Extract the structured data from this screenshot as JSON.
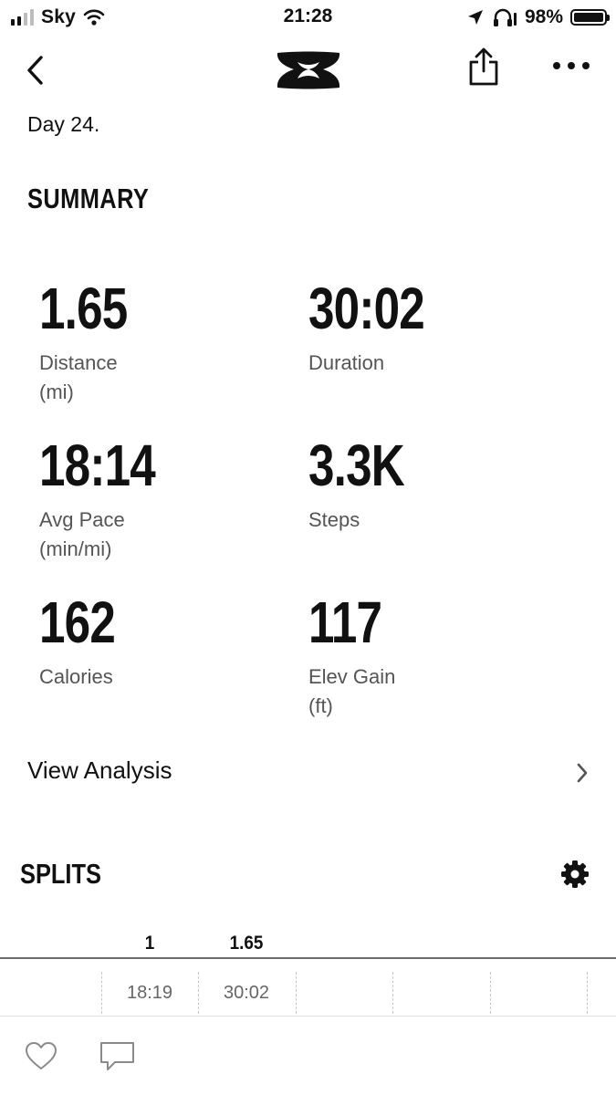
{
  "status_bar": {
    "carrier": "Sky",
    "time": "21:28",
    "battery_percent": "98%",
    "signal_bars_active": 2,
    "signal_bars_total": 4,
    "battery_level": 0.98,
    "icons": [
      "wifi-icon",
      "location-arrow-icon",
      "headphones-icon",
      "battery-icon"
    ]
  },
  "nav": {
    "back_icon": "chevron-left-icon",
    "logo": "under-armour-logo",
    "share_icon": "share-icon",
    "more_icon": "more-horizontal-icon"
  },
  "workout": {
    "title": "Day 24."
  },
  "summary": {
    "heading": "SUMMARY",
    "stats": [
      {
        "value": "1.65",
        "label": "Distance\n(mi)"
      },
      {
        "value": "30:02",
        "label": "Duration"
      },
      {
        "value": "18:14",
        "label": "Avg Pace\n(min/mi)"
      },
      {
        "value": "3.3K",
        "label": "Steps"
      },
      {
        "value": "162",
        "label": "Calories"
      },
      {
        "value": "117",
        "label": "Elev Gain\n(ft)"
      }
    ]
  },
  "analysis": {
    "label": "View Analysis",
    "icon": "chevron-right-icon"
  },
  "splits": {
    "heading": "SPLITS",
    "settings_icon": "gear-icon",
    "columns": [
      "1",
      "1.65"
    ],
    "values": [
      "18:19",
      "30:02"
    ]
  },
  "bottom_bar": {
    "like_icon": "heart-icon",
    "comment_icon": "comment-icon"
  },
  "colors": {
    "text": "#111111",
    "secondary_text": "#555555",
    "muted_text": "#666666",
    "divider": "#6b6b6b",
    "background": "#ffffff"
  }
}
